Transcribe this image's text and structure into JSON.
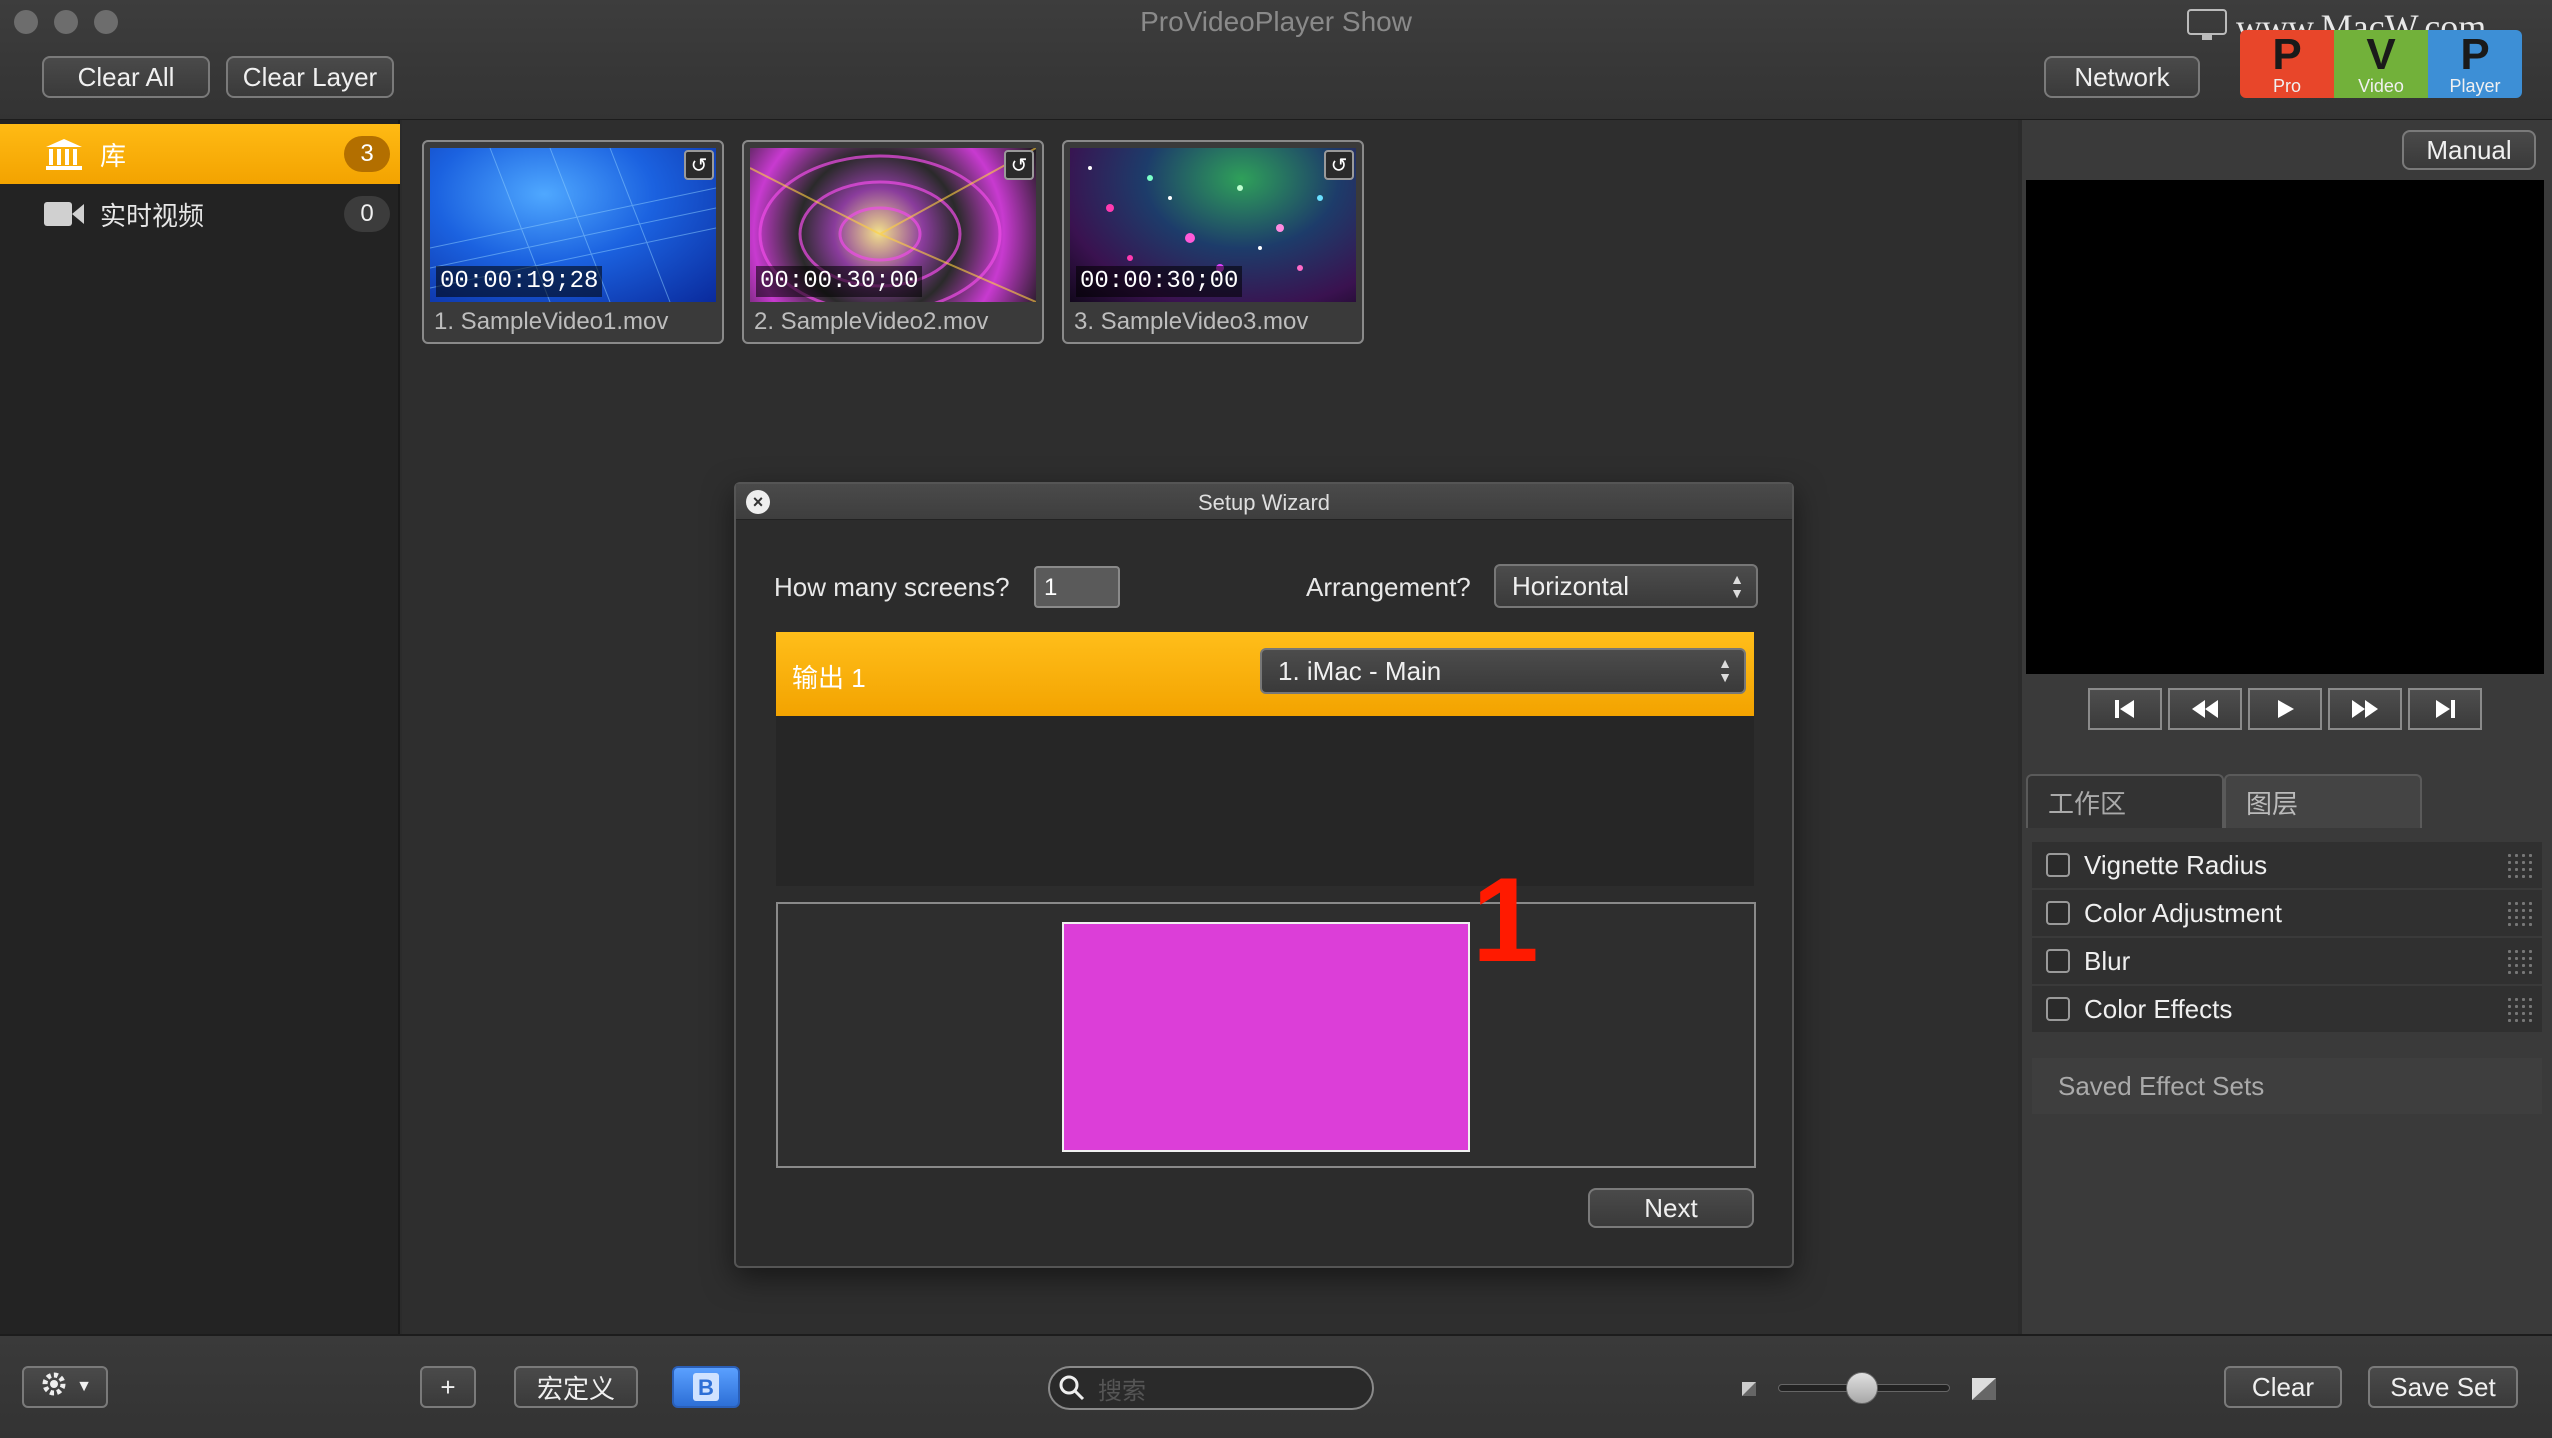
{
  "window": {
    "title": "ProVideoPlayer Show",
    "watermark": "www.MacW.com"
  },
  "logo": {
    "cells": [
      {
        "letter": "P",
        "word": "Pro",
        "color": "#e8462a"
      },
      {
        "letter": "V",
        "word": "Video",
        "color": "#72b13a"
      },
      {
        "letter": "P",
        "word": "Player",
        "color": "#3d8fd6"
      }
    ]
  },
  "toolbar": {
    "clear_all": "Clear All",
    "clear_layer": "Clear Layer",
    "network": "Network"
  },
  "sidebar": {
    "items": [
      {
        "label": "库",
        "count": "3",
        "icon": "library-icon",
        "active": true
      },
      {
        "label": "实时视频",
        "count": "0",
        "icon": "video-camera-icon",
        "active": false
      }
    ]
  },
  "media": {
    "items": [
      {
        "timecode": "00:00:19;28",
        "name": "1. SampleVideo1.mov"
      },
      {
        "timecode": "00:00:30;00",
        "name": "2. SampleVideo2.mov"
      },
      {
        "timecode": "00:00:30;00",
        "name": "3. SampleVideo3.mov"
      }
    ]
  },
  "wizard": {
    "title": "Setup Wizard",
    "screens_label": "How many screens?",
    "screens_value": "1",
    "arrangement_label": "Arrangement?",
    "arrangement_value": "Horizontal",
    "output_label": "输出 1",
    "output_display": "1. iMac - Main",
    "screen_number": "1",
    "next_label": "Next",
    "screen_color": "#dc3ed8",
    "number_color": "#ff1a00"
  },
  "right_panel": {
    "manual_label": "Manual",
    "tabs": [
      "工作区",
      "图层"
    ],
    "effects": [
      "Vignette Radius",
      "Color Adjustment",
      "Blur",
      "Color Effects"
    ],
    "saved_sets_label": "Saved Effect Sets"
  },
  "bottombar": {
    "macro_label": "宏定义",
    "search_placeholder": "搜索",
    "clear_label": "Clear",
    "save_set_label": "Save Set",
    "add_label": "+"
  },
  "colors": {
    "accent": "#f7ab06"
  }
}
